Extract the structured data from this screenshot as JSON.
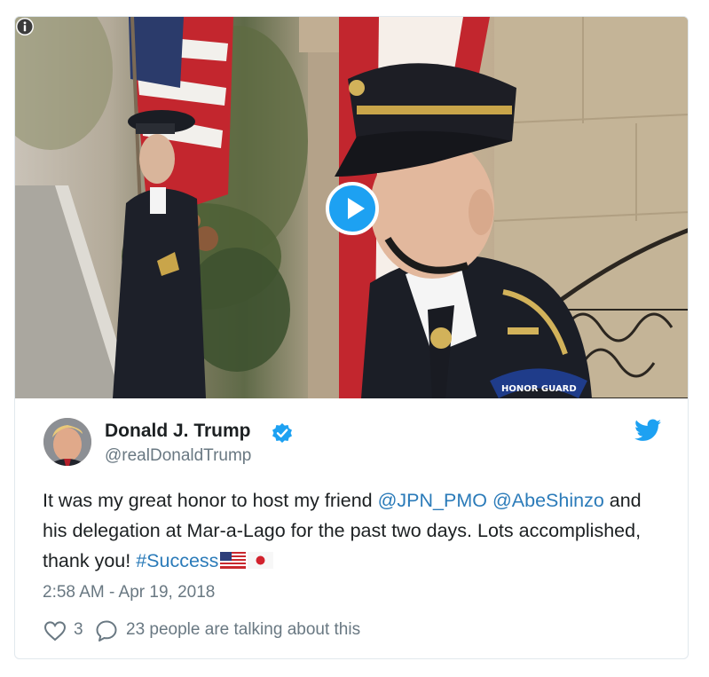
{
  "tweet": {
    "author": {
      "name": "Donald J. Trump",
      "handle": "@realDonaldTrump"
    },
    "text": {
      "part1": "It was my great honor to host my friend ",
      "mention1": "@JPN_PMO",
      "mention2": "@AbeShinzo",
      "part2": " and his delegation at Mar-a-Lago for the past two days. Lots accomplished, thank you! ",
      "hashtag": "#Success"
    },
    "timestamp": "2:58 AM - Apr 19, 2018",
    "likes": "3",
    "talking": "23 people are talking about this"
  },
  "media": {
    "badge": "HONOR GUARD"
  },
  "colors": {
    "brand_blue": "#1da1f2",
    "link_blue": "#2b7bb9",
    "muted_gray": "#697882"
  },
  "icons": [
    "info-icon",
    "play-icon",
    "verified-icon",
    "twitter-bird-icon",
    "heart-icon",
    "speech-bubble-icon",
    "us-flag-icon",
    "japan-flag-icon"
  ]
}
